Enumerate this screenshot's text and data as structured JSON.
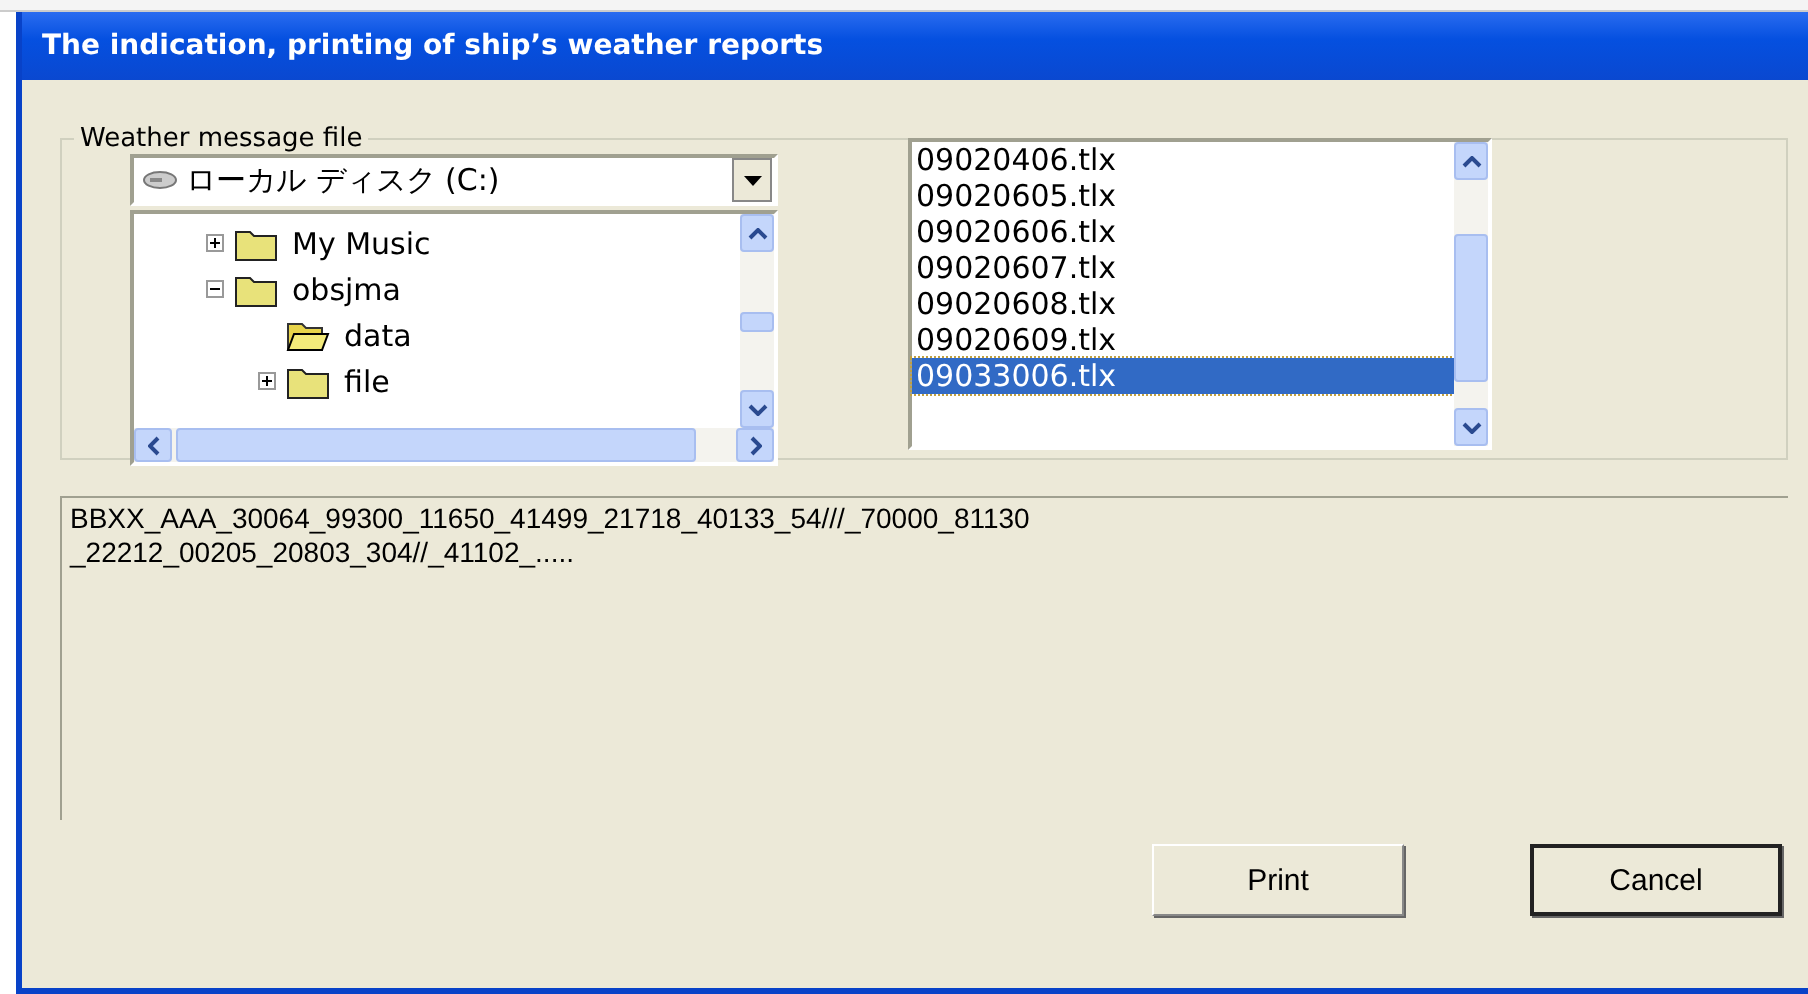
{
  "window": {
    "title": "The indication, printing of ship’s weather reports"
  },
  "file_group": {
    "label": "Weather message file",
    "drive": {
      "value": "ローカル ディスク (C:)"
    },
    "tree": [
      {
        "label": "My Music",
        "expanded": false,
        "selected": false
      },
      {
        "label": "obsjma",
        "expanded": true,
        "selected": false,
        "children": [
          {
            "label": "data",
            "selected": true
          },
          {
            "label": "file",
            "expanded": false,
            "selected": false
          }
        ]
      }
    ],
    "files": [
      {
        "label": "09020406.tlx",
        "selected": false
      },
      {
        "label": "09020605.tlx",
        "selected": false
      },
      {
        "label": "09020606.tlx",
        "selected": false
      },
      {
        "label": "09020607.tlx",
        "selected": false
      },
      {
        "label": "09020608.tlx",
        "selected": false
      },
      {
        "label": "09020609.tlx",
        "selected": false
      },
      {
        "label": "09033006.tlx",
        "selected": true
      }
    ]
  },
  "message": {
    "lines": [
      "BBXX_AAA_30064_99300_11650_41499_21718_40133_54///_70000_81130",
      "_22212_00205_20803_304//_41102_....."
    ]
  },
  "buttons": [
    "Print",
    "Cancel"
  ]
}
